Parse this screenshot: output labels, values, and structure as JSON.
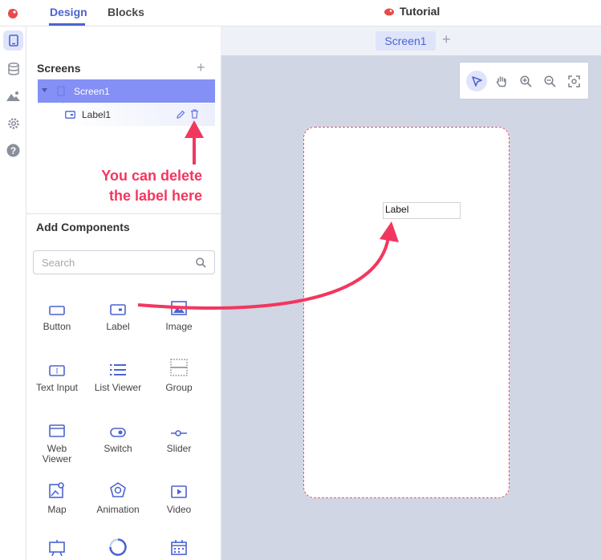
{
  "topbar": {
    "design_tab": "Design",
    "blocks_tab": "Blocks",
    "project_name": "Tutorial"
  },
  "rail": {
    "items": [
      "screen-icon",
      "database-icon",
      "image-icon",
      "gear-icon",
      "help-icon"
    ]
  },
  "screenbar": {
    "active_screen": "Screen1",
    "add_symbol": "+"
  },
  "screens": {
    "title": "Screens",
    "add_symbol": "+",
    "screen_item": "Screen1",
    "child_item": "Label1"
  },
  "annotation": {
    "line1": "You can delete",
    "line2": "the label here"
  },
  "add_components": {
    "title": "Add Components",
    "search_placeholder": "Search",
    "items": [
      {
        "label": "Button",
        "icon": "button-icon"
      },
      {
        "label": "Label",
        "icon": "label-icon"
      },
      {
        "label": "Image",
        "icon": "image-icon"
      },
      {
        "label": "Text Input",
        "icon": "text-input-icon"
      },
      {
        "label": "List Viewer",
        "icon": "list-icon"
      },
      {
        "label": "Group",
        "icon": "group-icon"
      },
      {
        "label": "Web Viewer",
        "icon": "web-viewer-icon"
      },
      {
        "label": "Switch",
        "icon": "switch-icon"
      },
      {
        "label": "Slider",
        "icon": "slider-icon"
      },
      {
        "label": "Map",
        "icon": "map-icon"
      },
      {
        "label": "Animation",
        "icon": "animation-icon"
      },
      {
        "label": "Video",
        "icon": "video-icon"
      }
    ]
  },
  "canvas": {
    "label_component_text": "Label",
    "toolbar": [
      "pointer-icon",
      "hand-icon",
      "zoom-in-icon",
      "zoom-out-icon",
      "fit-screen-icon"
    ]
  },
  "colors": {
    "accent": "#4b63d1",
    "annotation": "#f2375f",
    "canvas_bg": "#d1d6e4",
    "tree_selected": "#8490f5"
  }
}
